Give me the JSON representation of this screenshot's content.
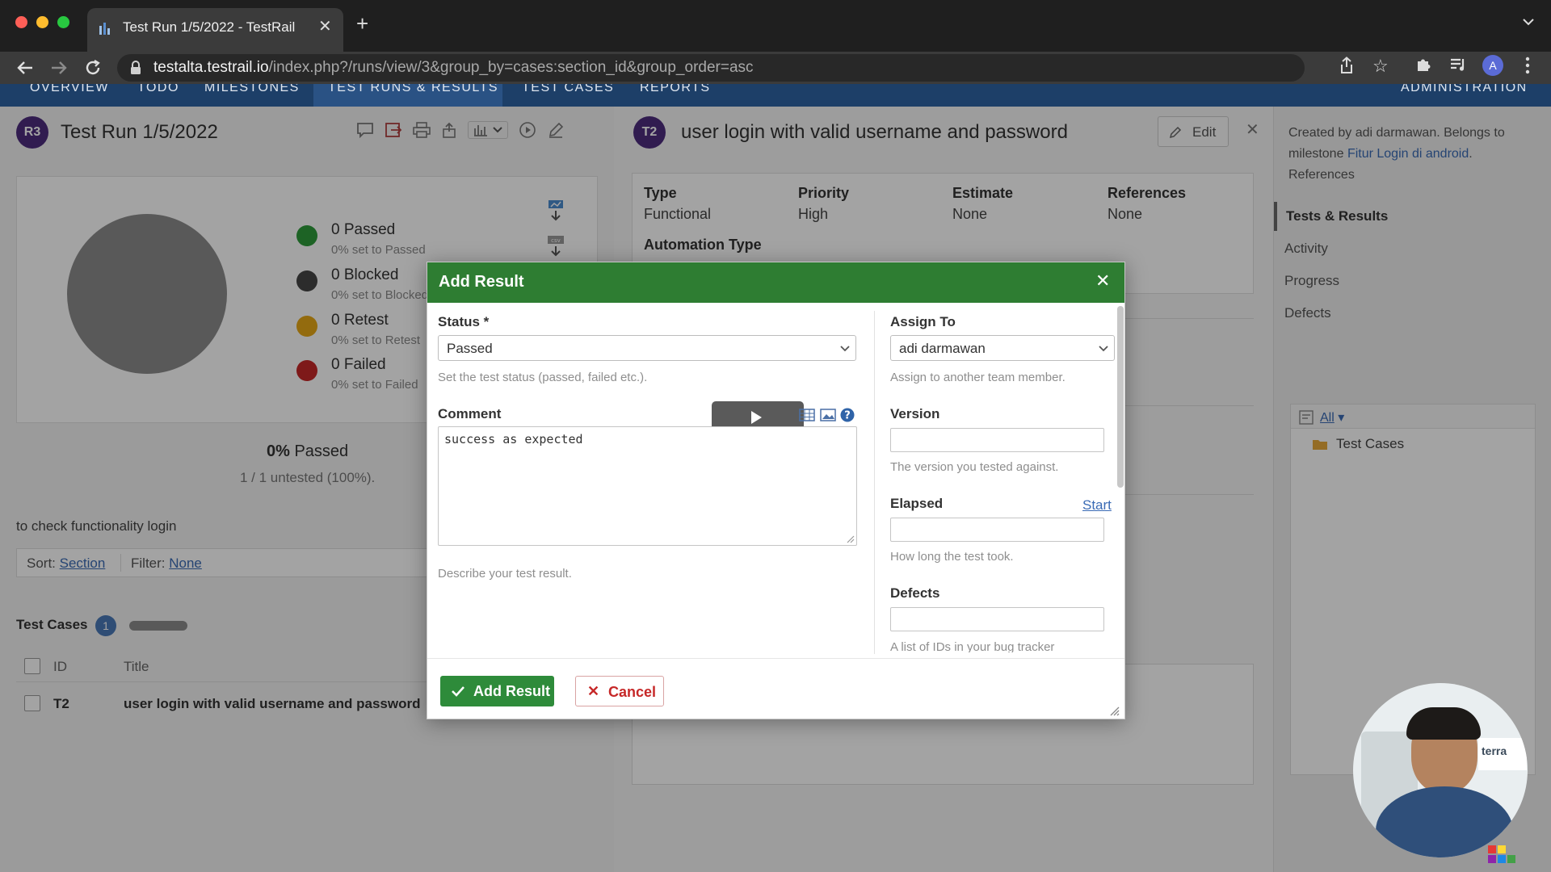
{
  "browser": {
    "tab_title": "Test Run 1/5/2022 - TestRail",
    "url_domain": "testalta.testrail.io",
    "url_path": "/index.php?/runs/view/3&group_by=cases:section_id&group_order=asc",
    "profile_initial": "A"
  },
  "nav": {
    "items": [
      "OVERVIEW",
      "TODO",
      "MILESTONES",
      "TEST RUNS & RESULTS",
      "TEST CASES",
      "REPORTS"
    ],
    "admin": "ADMINISTRATION"
  },
  "run": {
    "badge": "R3",
    "title": "Test Run 1/5/2022",
    "legend": [
      {
        "label": "0 Passed",
        "sub": "0% set to Passed",
        "color": "#2e9b3a"
      },
      {
        "label": "0 Blocked",
        "sub": "0% set to Blocked",
        "color": "#454545"
      },
      {
        "label": "0 Retest",
        "sub": "0% set to Retest",
        "color": "#e6a817"
      },
      {
        "label": "0 Failed",
        "sub": "0% set to Failed",
        "color": "#c62828"
      }
    ],
    "percent_value": "0%",
    "percent_label": "Passed",
    "untested": "1 / 1 untested (100%).",
    "description": "to check functionality login",
    "sort_label": "Sort:",
    "sort_value": "Section",
    "filter_label": "Filter:",
    "filter_value": "None",
    "cases_heading": "Test Cases",
    "cases_count": "1",
    "col_id": "ID",
    "col_title": "Title",
    "row_id": "T2",
    "row_title": "user login with valid username and password"
  },
  "test": {
    "badge": "T2",
    "title": "user login with valid username and password",
    "edit_label": "Edit",
    "fields": [
      {
        "label": "Type",
        "value": "Functional"
      },
      {
        "label": "Priority",
        "value": "High"
      },
      {
        "label": "Estimate",
        "value": "None"
      },
      {
        "label": "References",
        "value": "None"
      }
    ],
    "automation_label": "Automation Type"
  },
  "sidebar": {
    "created_by": "Created by adi darmawan. Belongs to milestone",
    "milestone_link": "Fitur Login di android",
    "references": "References",
    "links": [
      "Tests & Results",
      "Activity",
      "Progress",
      "Defects"
    ],
    "filter_all": "All",
    "folder": "Test Cases"
  },
  "modal": {
    "title": "Add Result",
    "status_label": "Status *",
    "status_value": "Passed",
    "status_help": "Set the test status (passed, failed etc.).",
    "comment_label": "Comment",
    "comment_value": "success as expected",
    "comment_help": "Describe your test result.",
    "assign_label": "Assign To",
    "assign_value": "adi darmawan",
    "assign_help": "Assign to another team member.",
    "version_label": "Version",
    "version_help": "The version you tested against.",
    "elapsed_label": "Elapsed",
    "elapsed_start": "Start",
    "elapsed_help": "How long the test took.",
    "defects_label": "Defects",
    "defects_help": "A list of IDs in your bug tracker",
    "add_button": "Add Result",
    "cancel_button": "Cancel"
  },
  "webcam": {
    "sign_text": "terra"
  },
  "colors": {
    "nav_bg": "#1d3f68",
    "modal_header": "#2e7d32",
    "badge": "#4d2d7e"
  }
}
